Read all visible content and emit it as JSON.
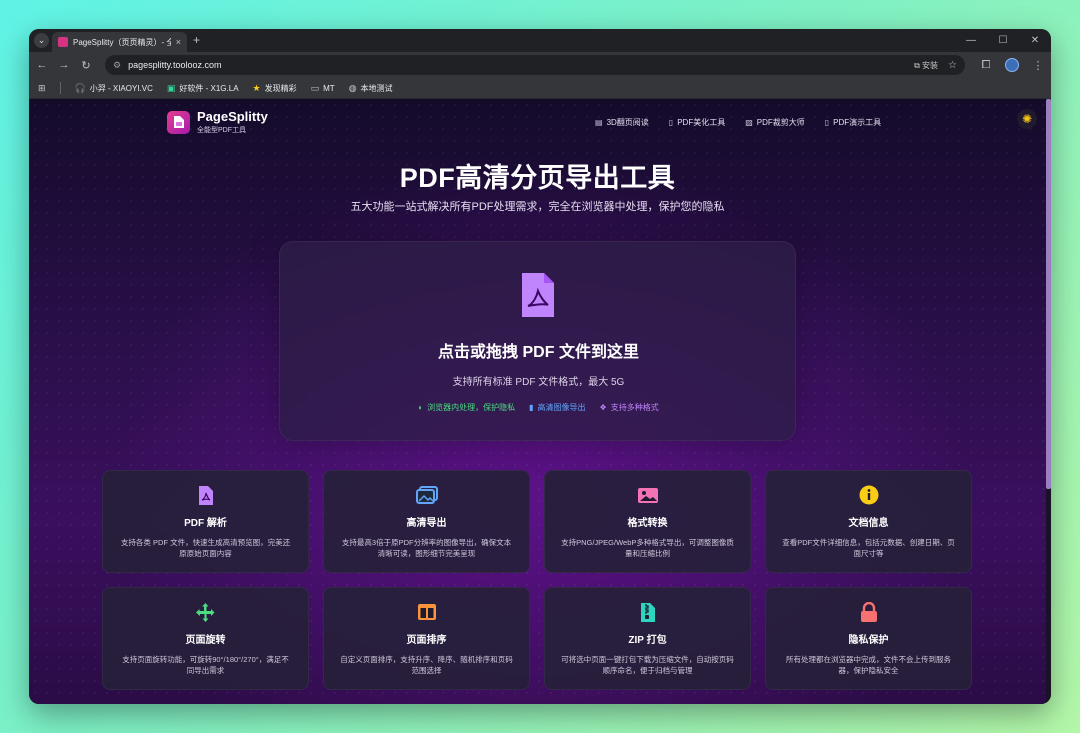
{
  "browser": {
    "tab_title": "PageSplitty（页页精灵）- 全能",
    "tab_close": "×",
    "new_tab": "+",
    "url": "pagesplitty.toolooz.com",
    "install_label": "安装",
    "bookmarks": [
      {
        "icon": "headphones-icon",
        "label": "小羿 - XIAOYI.VC"
      },
      {
        "icon": "app-icon",
        "label": "好软件 - X1G.LA"
      },
      {
        "icon": "star-icon",
        "label": "发现精彩"
      },
      {
        "icon": "folder-icon",
        "label": "MT"
      },
      {
        "icon": "globe-icon",
        "label": "本地测试"
      }
    ]
  },
  "site": {
    "logo_name": "PageSplitty",
    "logo_sub": "全能型PDF工具",
    "nav": [
      {
        "label": "3D翻页阅读"
      },
      {
        "label": "PDF美化工具"
      },
      {
        "label": "PDF裁剪大师"
      },
      {
        "label": "PDF演示工具"
      }
    ]
  },
  "hero": {
    "title": "PDF高清分页导出工具",
    "subtitle": "五大功能一站式解决所有PDF处理需求，完全在浏览器中处理，保护您的隐私"
  },
  "dropzone": {
    "title": "点击或拖拽 PDF 文件到这里",
    "subtitle": "支持所有标准 PDF 文件格式，最大 5G",
    "features": [
      {
        "label": "浏览器内处理，保护隐私",
        "color": "#4ade80"
      },
      {
        "label": "高清图像导出",
        "color": "#60a5fa"
      },
      {
        "label": "支持多种格式",
        "color": "#c084fc"
      }
    ]
  },
  "features": [
    {
      "icon": "pdf-file-icon",
      "color": "#c084fc",
      "title": "PDF 解析",
      "desc": "支持各类 PDF 文件，快速生成高清预览图，完美还原原始页面内容"
    },
    {
      "icon": "images-icon",
      "color": "#60a5fa",
      "title": "高清导出",
      "desc": "支持最高3倍于原PDF分辨率的图像导出，确保文本清晰可读，图形细节完美呈现"
    },
    {
      "icon": "image-icon",
      "color": "#f472b6",
      "title": "格式转换",
      "desc": "支持PNG/JPEG/WebP多种格式导出，可调整图像质量和压缩比例"
    },
    {
      "icon": "info-icon",
      "color": "#facc15",
      "title": "文档信息",
      "desc": "查看PDF文件详细信息，包括元数据、创建日期、页面尺寸等"
    },
    {
      "icon": "arrows-move-icon",
      "color": "#4ade80",
      "title": "页面旋转",
      "desc": "支持页面旋转功能，可旋转90°/180°/270°，满足不同导出需求"
    },
    {
      "icon": "columns-icon",
      "color": "#fb923c",
      "title": "页面排序",
      "desc": "自定义页面排序，支持升序、降序、随机排序和页码范围选择"
    },
    {
      "icon": "zip-file-icon",
      "color": "#2dd4bf",
      "title": "ZIP 打包",
      "desc": "可将选中页面一键打包下载为压缩文件，自动按页码顺序命名，便于归档与管理"
    },
    {
      "icon": "lock-icon",
      "color": "#f87171",
      "title": "隐私保护",
      "desc": "所有处理都在浏览器中完成，文件不会上传到服务器，保护隐私安全"
    }
  ]
}
